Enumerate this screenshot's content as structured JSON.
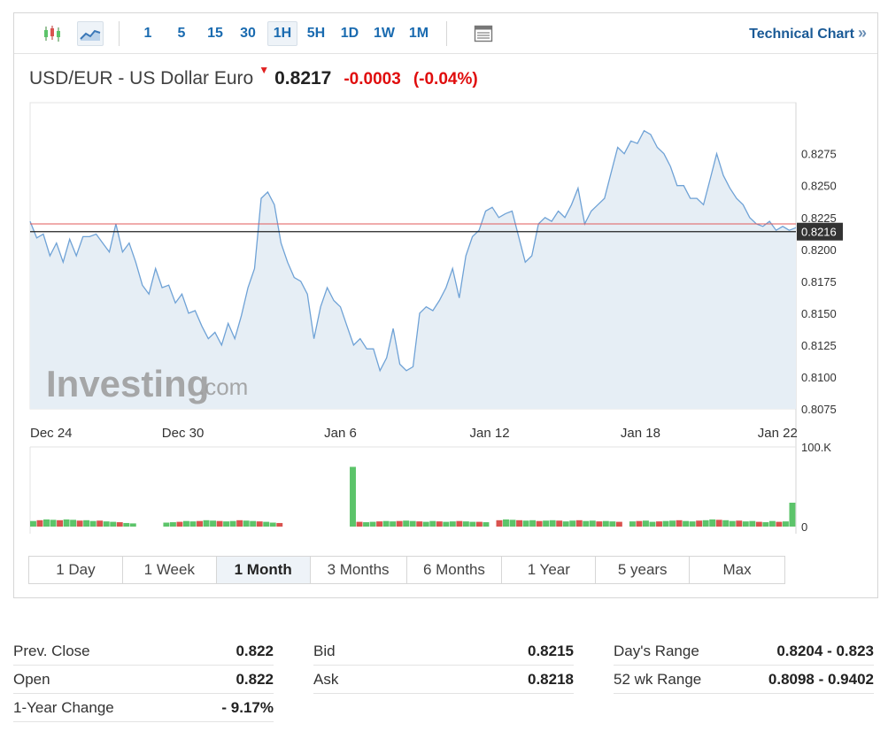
{
  "toolbar": {
    "icons": [
      "candlestick-chart-icon",
      "area-chart-icon",
      "table-icon"
    ],
    "timeframes": [
      "1",
      "5",
      "15",
      "30",
      "1H",
      "5H",
      "1D",
      "1W",
      "1M"
    ],
    "active_timeframe": "1H",
    "technical_chart_label": "Technical Chart",
    "technical_chart_chevron": "»"
  },
  "quote": {
    "title": "USD/EUR - US Dollar Euro",
    "direction_icon": "down-arrow-icon",
    "last": "0.8217",
    "change": "-0.0003",
    "change_pct": "(-0.04%)",
    "change_color": "#e00d0d"
  },
  "watermark": {
    "brand": "Investing",
    "suffix": ".com"
  },
  "chart_data": {
    "type": "area",
    "x_tick_labels": [
      "Dec 24",
      "Dec 30",
      "Jan 6",
      "Jan 12",
      "Jan 18",
      "Jan 22"
    ],
    "y_tick_labels": [
      "0.8275",
      "0.8250",
      "0.8225",
      "0.8200",
      "0.8175",
      "0.8150",
      "0.8125",
      "0.8100",
      "0.8075"
    ],
    "ylim": [
      0.8075,
      0.8315
    ],
    "last_price_label": "0.8216",
    "last_price": 0.8216,
    "prev_close_line": 0.822,
    "series": [
      {
        "values": [
          0.8222,
          0.8209,
          0.8212,
          0.8195,
          0.8205,
          0.819,
          0.8208,
          0.8195,
          0.821,
          0.821,
          0.8212,
          0.8205,
          0.8198,
          0.822,
          0.8198,
          0.8205,
          0.819,
          0.8172,
          0.8165,
          0.8185,
          0.817,
          0.8172,
          0.8158,
          0.8165,
          0.815,
          0.8152,
          0.814,
          0.813,
          0.8135,
          0.8125,
          0.8142,
          0.813,
          0.8148,
          0.817,
          0.8185,
          0.824,
          0.8245,
          0.8235,
          0.8205,
          0.819,
          0.8178,
          0.8175,
          0.8165,
          0.813,
          0.8155,
          0.817,
          0.816,
          0.8155,
          0.814,
          0.8125,
          0.813,
          0.8122,
          0.8122,
          0.8105,
          0.8115,
          0.8138,
          0.811,
          0.8105,
          0.8108,
          0.815,
          0.8155,
          0.8152,
          0.816,
          0.817,
          0.8185,
          0.8162,
          0.8195,
          0.821,
          0.8215,
          0.823,
          0.8233,
          0.8225,
          0.8228,
          0.823,
          0.821,
          0.819,
          0.8195,
          0.822,
          0.8225,
          0.8222,
          0.823,
          0.8225,
          0.8235,
          0.8248,
          0.822,
          0.823,
          0.8235,
          0.824,
          0.826,
          0.828,
          0.8275,
          0.8285,
          0.8283,
          0.8293,
          0.829,
          0.828,
          0.8275,
          0.8265,
          0.825,
          0.825,
          0.824,
          0.824,
          0.8235,
          0.8255,
          0.8275,
          0.8258,
          0.8248,
          0.824,
          0.8235,
          0.8225,
          0.822,
          0.8218,
          0.8222,
          0.8215,
          0.8218,
          0.8215,
          0.8217
        ]
      }
    ],
    "volume": {
      "ylim": [
        0,
        100000
      ],
      "y_tick_labels": [
        "100.K",
        "0"
      ],
      "values": [
        7000,
        8000,
        9000,
        8500,
        8000,
        9000,
        8500,
        7500,
        8000,
        7000,
        7500,
        6500,
        6000,
        5500,
        4500,
        4000,
        0,
        0,
        0,
        0,
        5000,
        5500,
        6000,
        7000,
        6500,
        7000,
        8000,
        7500,
        7000,
        6500,
        7000,
        8000,
        7500,
        7000,
        6500,
        6000,
        5000,
        4500,
        0,
        0,
        0,
        0,
        0,
        0,
        0,
        0,
        0,
        0,
        75000,
        6000,
        5500,
        6000,
        6500,
        7000,
        6500,
        7000,
        7500,
        7000,
        6500,
        6000,
        7000,
        6500,
        6000,
        6500,
        7000,
        6500,
        6000,
        6000,
        5500,
        0,
        8000,
        9000,
        8500,
        8000,
        7500,
        8000,
        7000,
        7500,
        8000,
        7500,
        6500,
        7500,
        8000,
        7000,
        7500,
        6500,
        7000,
        6500,
        6000,
        0,
        6500,
        7000,
        7500,
        6000,
        6500,
        7000,
        7500,
        8000,
        7000,
        6500,
        7500,
        8000,
        9000,
        8500,
        8000,
        7000,
        7500,
        6500,
        7000,
        6000,
        5500,
        7000,
        6000,
        6500,
        30000
      ],
      "up_color": "#5cc46a",
      "down_color": "#d9534f"
    },
    "colors": {
      "line": "#6fa2d6",
      "fill": "#e6eef5",
      "prev_close": "#e05a5a",
      "last_line": "#222222",
      "label_bg": "#333333"
    }
  },
  "periods": {
    "items": [
      "1 Day",
      "1 Week",
      "1 Month",
      "3 Months",
      "6 Months",
      "1 Year",
      "5 years",
      "Max"
    ],
    "active": "1 Month"
  },
  "stats": [
    [
      {
        "label": "Prev. Close",
        "value": "0.822"
      },
      {
        "label": "Open",
        "value": "0.822"
      },
      {
        "label": "1-Year Change",
        "value": "- 9.17%"
      }
    ],
    [
      {
        "label": "Bid",
        "value": "0.8215"
      },
      {
        "label": "Ask",
        "value": "0.8218"
      }
    ],
    [
      {
        "label": "Day's Range",
        "value": "0.8204 - 0.823"
      },
      {
        "label": "52 wk Range",
        "value": "0.8098 - 0.9402"
      }
    ]
  ]
}
